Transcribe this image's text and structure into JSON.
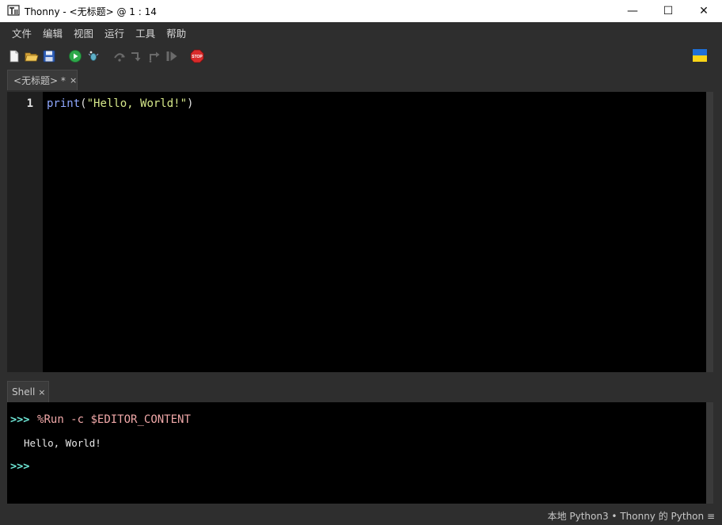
{
  "window": {
    "title": "Thonny  -  <无标题>  @  1 : 14",
    "controls": {
      "minimize": "—",
      "maximize": "☐",
      "close": "✕"
    }
  },
  "menu": {
    "items": [
      "文件",
      "编辑",
      "视图",
      "运行",
      "工具",
      "帮助"
    ]
  },
  "toolbar": {
    "icons": [
      "new-file-icon",
      "open-file-icon",
      "save-icon",
      "run-icon",
      "debug-icon",
      "step-over-icon",
      "step-into-icon",
      "step-out-icon",
      "resume-icon",
      "stop-icon",
      "ukraine-flag-icon"
    ],
    "stop_label": "STOP"
  },
  "editor": {
    "tab": {
      "label": "<无标题> *",
      "close": "×"
    },
    "lines": [
      {
        "number": "1",
        "builtin": "print",
        "open": "(",
        "string": "\"Hello, World!\"",
        "close": ")"
      }
    ]
  },
  "shell": {
    "tab": {
      "label": "Shell",
      "close": "×"
    },
    "prompt": ">>>",
    "command": "%Run -c $EDITOR_CONTENT",
    "output": "Hello, World!",
    "prompt2": ">>>"
  },
  "status": {
    "text": "本地 Python3  •  Thonny 的 Python  ≡"
  },
  "colors": {
    "background": "#2e2e2e",
    "editor_bg": "#000000",
    "prompt": "#6ee7d6",
    "command": "#f0a8a8",
    "string": "#d6e88a",
    "builtin": "#8fa8ff"
  }
}
